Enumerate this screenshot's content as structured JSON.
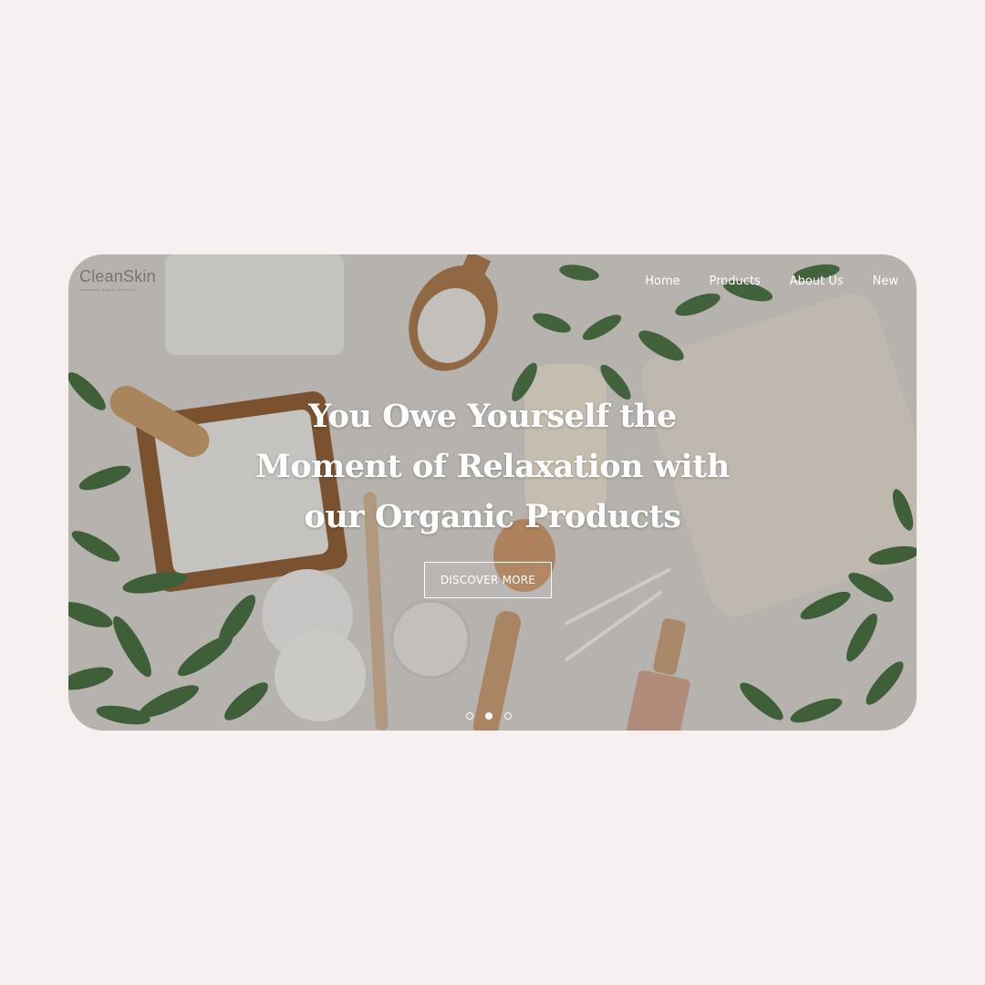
{
  "brand": {
    "name": "CleanSkin",
    "tagline": "handmade organic products"
  },
  "nav": {
    "items": [
      {
        "label": "Home"
      },
      {
        "label": "Products"
      },
      {
        "label": "About Us"
      },
      {
        "label": "New"
      }
    ]
  },
  "hero": {
    "headline_line1": "You Owe Yourself the",
    "headline_line2": "Moment of Relaxation with",
    "headline_line3": "our Organic Products",
    "cta_label": "DISCOVER MORE",
    "slides": {
      "count": 3,
      "active_index": 1
    }
  },
  "colors": {
    "page_background": "#f6f0f0",
    "text_on_image": "#ffffff",
    "leaf_green": "#3f6b3a"
  }
}
